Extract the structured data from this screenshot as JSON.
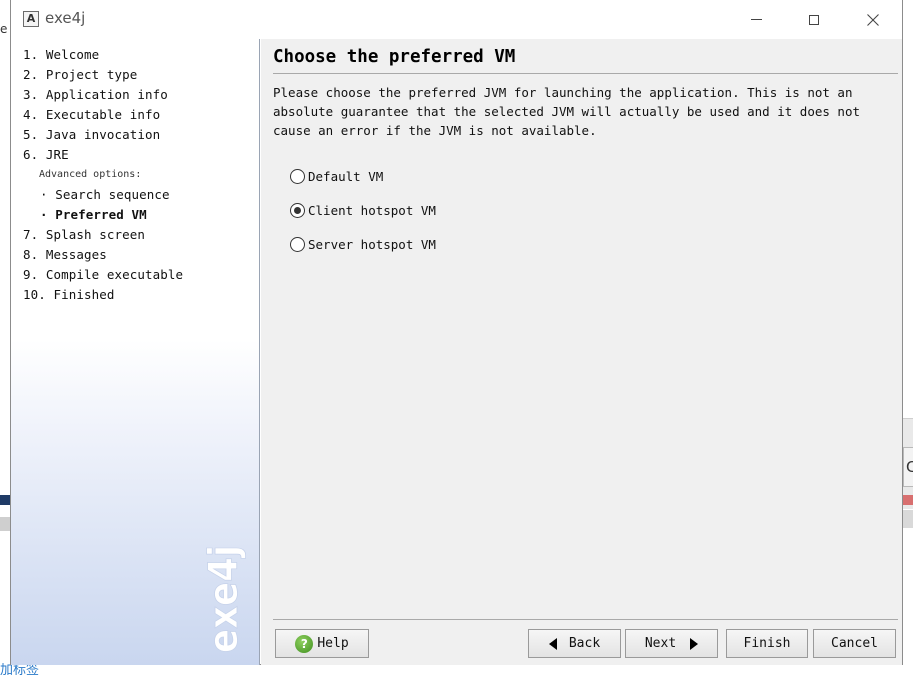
{
  "window": {
    "title": "exe4j",
    "icon": "app-icon",
    "icon_letter": "A"
  },
  "background": {
    "right_edge_text": "C",
    "bottom_link_text": "加标签"
  },
  "sidebar": {
    "steps": [
      {
        "label": "1. Welcome"
      },
      {
        "label": "2. Project type"
      },
      {
        "label": "3. Application info"
      },
      {
        "label": "4. Executable info"
      },
      {
        "label": "5. Java invocation"
      },
      {
        "label": "6. JRE"
      }
    ],
    "advanced_label": "Advanced options:",
    "sub_steps": [
      {
        "label": "· Search sequence",
        "active": false
      },
      {
        "label": "· Preferred VM",
        "active": true
      }
    ],
    "later_steps": [
      {
        "label": "7. Splash screen"
      },
      {
        "label": "8. Messages"
      },
      {
        "label": "9. Compile executable"
      },
      {
        "label": "10. Finished"
      }
    ],
    "watermark": "exe4j"
  },
  "main": {
    "title": "Choose the preferred VM",
    "description": "Please choose the preferred JVM for launching the application. This is not an\nabsolute guarantee that the selected JVM will actually be used and it does not\ncause an error if the JVM is not available.",
    "options": [
      {
        "label": "Default VM",
        "checked": false
      },
      {
        "label": "Client hotspot VM",
        "checked": true
      },
      {
        "label": "Server hotspot VM",
        "checked": false
      }
    ]
  },
  "buttons": {
    "help": "Help",
    "back": "Back",
    "next": "Next",
    "finish": "Finish",
    "cancel": "Cancel"
  },
  "icons": {
    "help": "help-icon",
    "back": "triangle-left-icon",
    "next": "triangle-right-icon",
    "minimize": "minimize-icon",
    "maximize": "maximize-icon",
    "close": "close-icon"
  }
}
